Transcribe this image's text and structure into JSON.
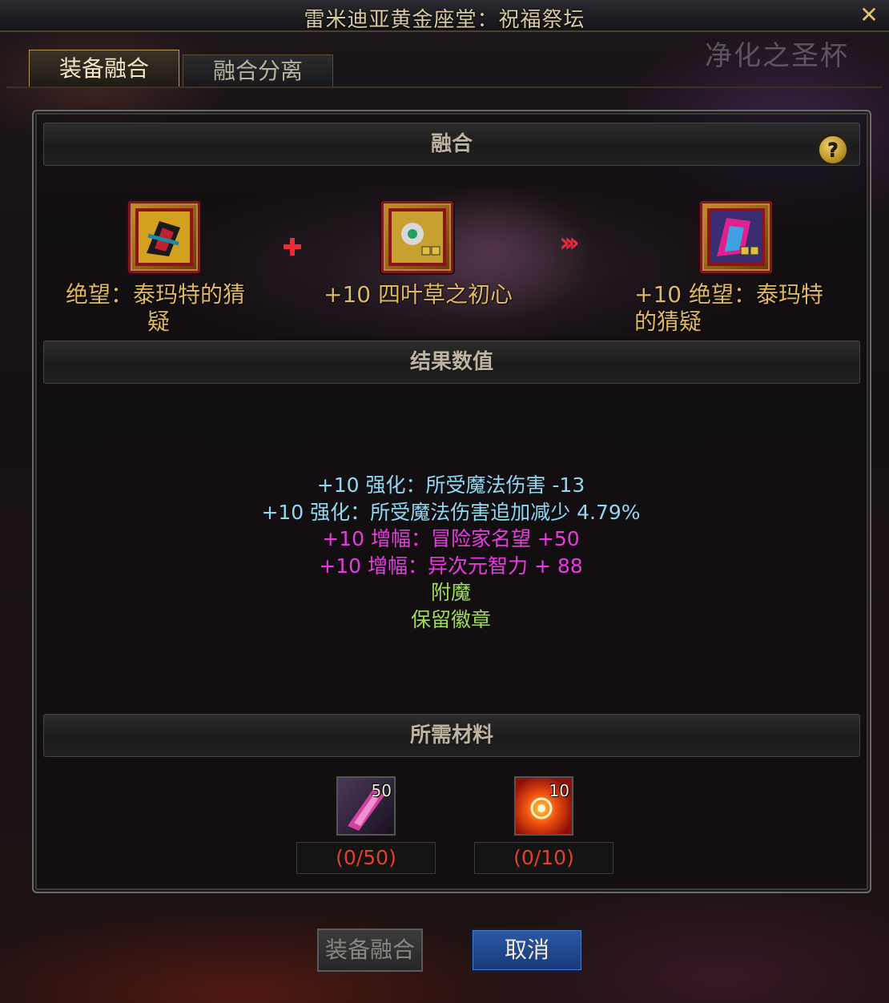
{
  "window": {
    "title": "雷米迪亚黄金座堂：祝福祭坛",
    "watermark": "净化之圣杯"
  },
  "tabs": [
    {
      "label": "装备融合",
      "active": true
    },
    {
      "label": "融合分离",
      "active": false
    }
  ],
  "sections": {
    "fusion": "融合",
    "result": "结果数值",
    "materials": "所需材料"
  },
  "fusion": {
    "item1": {
      "line1": "绝望：泰玛特的猜",
      "line2": "疑"
    },
    "item2": {
      "name": "+10 四叶草之初心"
    },
    "result": {
      "line1": "+10 绝望：泰玛特",
      "line2": "的猜疑"
    }
  },
  "stats": [
    {
      "text": "+10 强化：所受魔法伤害 -13",
      "color": "cyan"
    },
    {
      "text": "+10 强化：所受魔法伤害追加减少 4.79%",
      "color": "cyan"
    },
    {
      "text": "+10 增幅：冒险家名望 +50",
      "color": "magenta"
    },
    {
      "text": "+10 增幅：异次元智力 + 88",
      "color": "magenta"
    },
    {
      "text": "附魔",
      "color": "green"
    },
    {
      "text": "保留徽章",
      "color": "green"
    }
  ],
  "materials": [
    {
      "icon": "crystal-icon",
      "stack": "50",
      "required": "(0/50)"
    },
    {
      "icon": "sun-orb-icon",
      "stack": "10",
      "required": "(0/10)"
    }
  ],
  "buttons": {
    "fuse": "装备融合",
    "cancel": "取消"
  },
  "help_label": "?",
  "close_label": "✕",
  "colors": {
    "item_name": "#e0b860",
    "stat_cyan": "#8fd8f0",
    "stat_magenta": "#e83ce0",
    "stat_green": "#9edc52",
    "material_count": "#e0402e",
    "cancel_button": "#2b58a6"
  }
}
